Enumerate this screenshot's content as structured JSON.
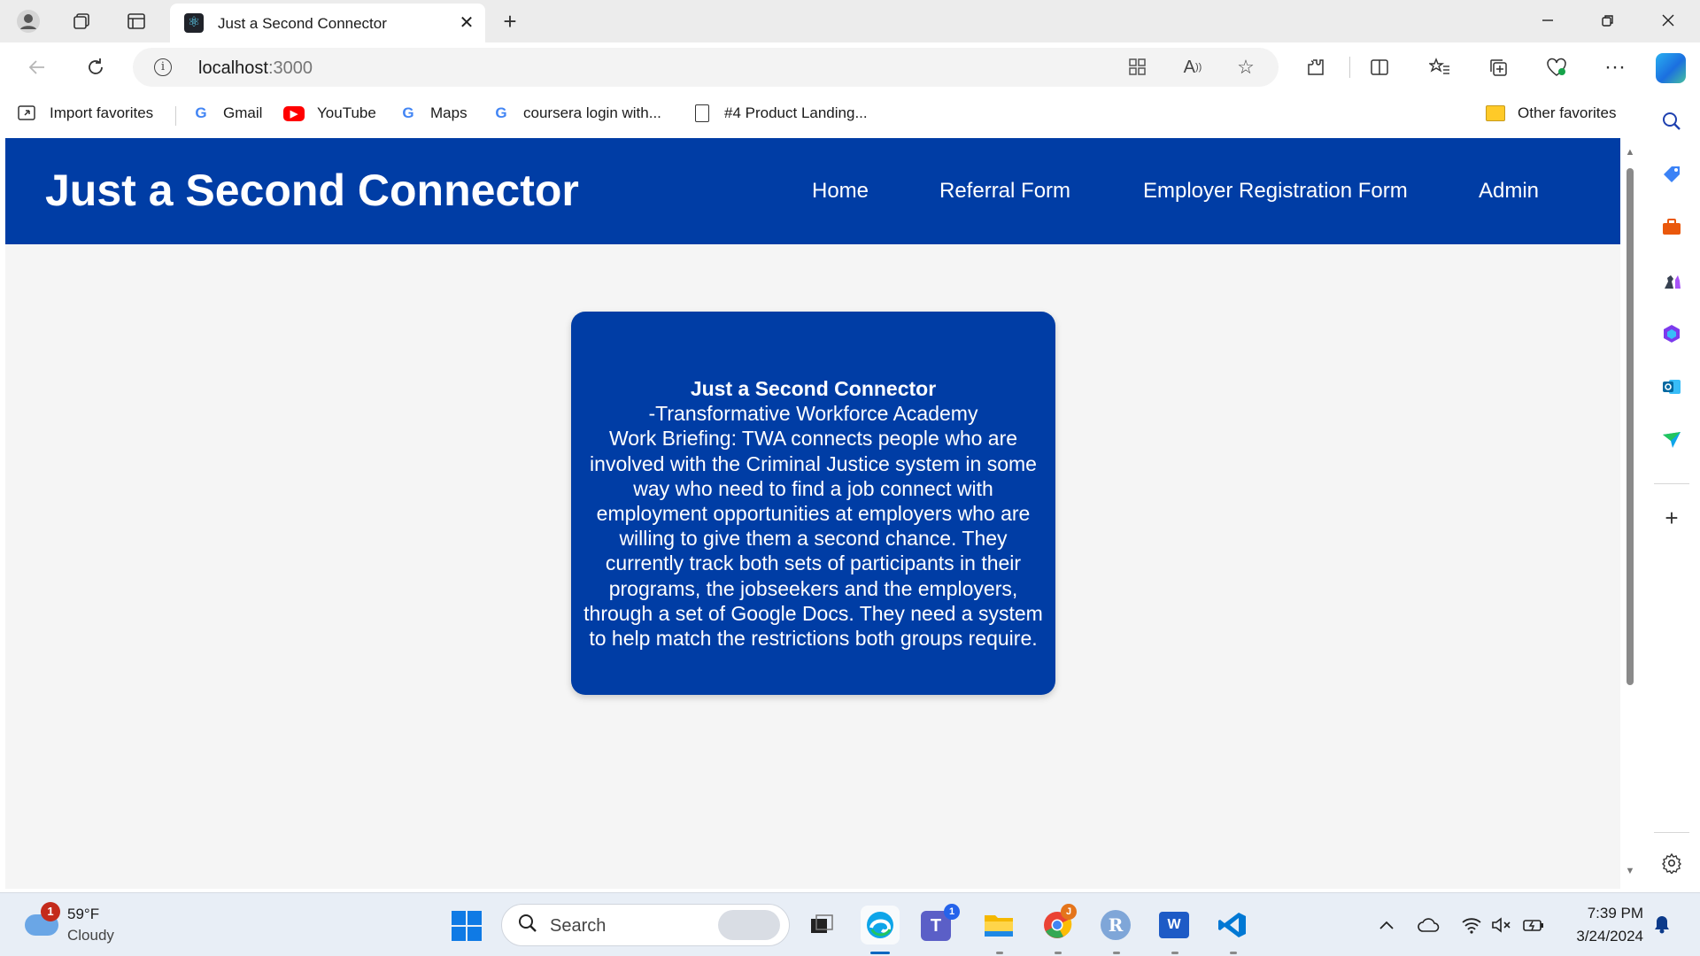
{
  "browser": {
    "tab": {
      "title": "Just a Second Connector",
      "favicon": "react-icon"
    },
    "address": {
      "host": "localhost",
      "port": ":3000"
    },
    "favorites": [
      {
        "label": "Import favorites",
        "icon": "import-icon"
      },
      {
        "label": "Gmail",
        "icon": "google-icon"
      },
      {
        "label": "YouTube",
        "icon": "youtube-icon"
      },
      {
        "label": "Maps",
        "icon": "google-icon"
      },
      {
        "label": "coursera login with...",
        "icon": "google-icon"
      },
      {
        "label": "#4 Product Landing...",
        "icon": "page-icon"
      },
      {
        "label": "Other favorites",
        "icon": "folder-icon"
      }
    ]
  },
  "app": {
    "brand": "Just a Second Connector",
    "nav": [
      "Home",
      "Referral Form",
      "Employer Registration Form",
      "Admin"
    ],
    "header_color": "#003da5",
    "card": {
      "title": "Just a Second Connector",
      "subtitle": "-Transformative Workforce Academy",
      "body": "Work Briefing: TWA connects people who are involved with the Criminal Justice system in some way who need to find a job connect with employment opportunities at employers who are willing to give them a second chance. They currently track both sets of participants in their programs, the jobseekers and the employers, through a set of Google Docs. They need a system to help match the restrictions both groups require."
    }
  },
  "taskbar": {
    "weather": {
      "temp": "59°F",
      "condition": "Cloudy",
      "badge": "1"
    },
    "search_placeholder": "Search",
    "teams_badge": "1",
    "chrome_badge": "J",
    "r_label": "R",
    "word_label": "W",
    "clock": {
      "time": "7:39 PM",
      "date": "3/24/2024"
    }
  }
}
